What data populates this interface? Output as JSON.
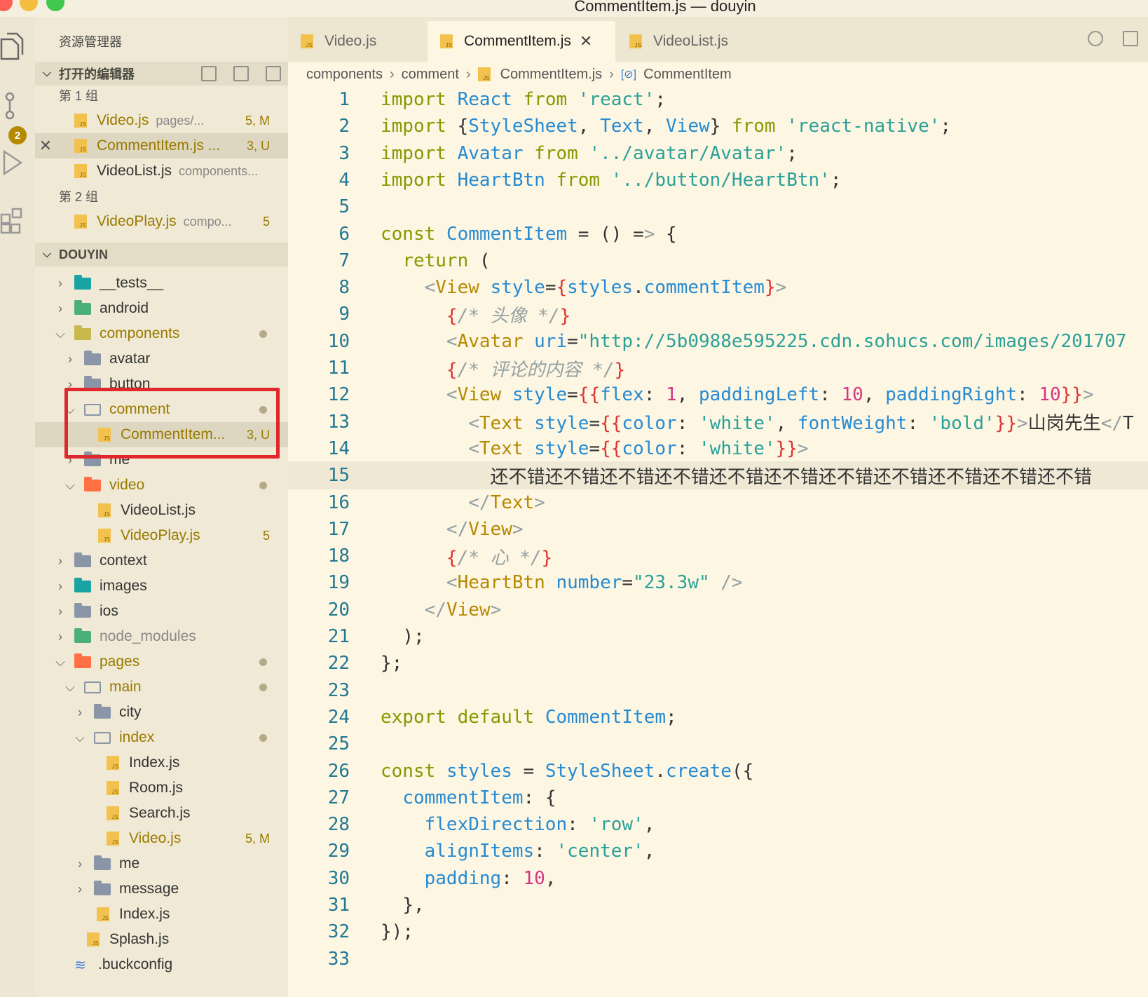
{
  "window": {
    "title": "CommentItem.js — douyin"
  },
  "activity_bar": {
    "items": [
      "explorer-icon",
      "source-control-icon",
      "run-debug-icon",
      "extensions-icon"
    ],
    "scm_badge": "2"
  },
  "sidebar": {
    "title": "资源管理器",
    "open_editors_header": "打开的编辑器",
    "groups": [
      {
        "label": "第 1 组",
        "files": [
          {
            "name": "Video.js",
            "path": "pages/...",
            "status": "5, M"
          },
          {
            "name": "CommentItem.js ...",
            "path": "",
            "status": "3, U"
          },
          {
            "name": "VideoList.js",
            "path": "components...",
            "status": ""
          }
        ]
      },
      {
        "label": "第 2 组",
        "files": [
          {
            "name": "VideoPlay.js",
            "path": "compo...",
            "status": "5"
          }
        ]
      }
    ],
    "workspace_header": "DOUYIN",
    "tree": [
      {
        "name": "__tests__"
      },
      {
        "name": "android"
      },
      {
        "name": "components"
      },
      {
        "name": "avatar"
      },
      {
        "name": "button"
      },
      {
        "name": "comment"
      },
      {
        "name": "CommentItem...",
        "status": "3, U"
      },
      {
        "name": "me"
      },
      {
        "name": "video"
      },
      {
        "name": "VideoList.js"
      },
      {
        "name": "VideoPlay.js",
        "status": "5"
      },
      {
        "name": "context"
      },
      {
        "name": "images"
      },
      {
        "name": "ios"
      },
      {
        "name": "node_modules"
      },
      {
        "name": "pages"
      },
      {
        "name": "main"
      },
      {
        "name": "city"
      },
      {
        "name": "index"
      },
      {
        "name": "Index.js"
      },
      {
        "name": "Room.js"
      },
      {
        "name": "Search.js"
      },
      {
        "name": "Video.js",
        "status": "5, M"
      },
      {
        "name": "me"
      },
      {
        "name": "message"
      },
      {
        "name": "Index.js"
      },
      {
        "name": "Splash.js"
      },
      {
        "name": ".buckconfig"
      }
    ]
  },
  "tabs": [
    {
      "label": "Video.js"
    },
    {
      "label": "CommentItem.js"
    },
    {
      "label": "VideoList.js"
    }
  ],
  "breadcrumb": [
    "components",
    "comment",
    "CommentItem.js",
    "CommentItem"
  ],
  "colors": {
    "keyword_green": "#859900",
    "identifier_blue": "#268bd2",
    "string_cyan": "#2aa198",
    "number_magenta": "#d33682",
    "brace_red": "#dc322f",
    "comment_gray": "#93a1a1",
    "tag_orange": "#b58900"
  },
  "code": {
    "line_numbers": [
      "1",
      "2",
      "3",
      "4",
      "5",
      "6",
      "7",
      "8",
      "9",
      "10",
      "11",
      "12",
      "13",
      "14",
      "15",
      "16",
      "17",
      "18",
      "19",
      "20",
      "21",
      "22",
      "23",
      "24",
      "25",
      "26",
      "27",
      "28",
      "29",
      "30",
      "31",
      "32",
      "33"
    ],
    "lines": [
      "import React from 'react';",
      "import {StyleSheet, Text, View} from 'react-native';",
      "import Avatar from '../avatar/Avatar';",
      "import HeartBtn from '../button/HeartBtn';",
      "",
      "const CommentItem = () => {",
      "  return (",
      "    <View style={styles.commentItem}>",
      "      {/* 头像 */}",
      "      <Avatar uri=\"http://5b0988e595225.cdn.sohucs.com/images/201707",
      "      {/* 评论的内容 */}",
      "      <View style={{flex: 1, paddingLeft: 10, paddingRight: 10}}>",
      "        <Text style={{color: 'white', fontWeight: 'bold'}}>山岗先生</T",
      "        <Text style={{color: 'white'}}>",
      "          还不错还不错还不错还不错还不错还不错还不错还不错还不错还不错还不错",
      "        </Text>",
      "      </View>",
      "      {/* 心 */}",
      "      <HeartBtn number=\"23.3w\" />",
      "    </View>",
      "  );",
      "};",
      "",
      "export default CommentItem;",
      "",
      "const styles = StyleSheet.create({",
      "  commentItem: {",
      "    flexDirection: 'row',",
      "    alignItems: 'center',",
      "    padding: 10,",
      "  },",
      "});",
      ""
    ]
  }
}
